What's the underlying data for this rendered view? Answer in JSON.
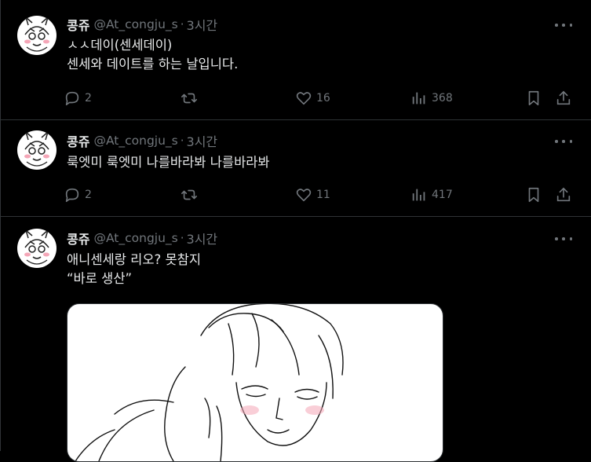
{
  "tweets": [
    {
      "name": "콩쥬",
      "handle": "@At_congju_s",
      "dot": "·",
      "time": "3시간",
      "lines": [
        "ㅅㅅ데이(센세데이)",
        "센세와 데이트를 하는 날입니다."
      ],
      "replies": "2",
      "likes": "16",
      "views": "368"
    },
    {
      "name": "콩쥬",
      "handle": "@At_congju_s",
      "dot": "·",
      "time": "3시간",
      "lines": [
        "룩엣미 룩엣미 나를바라봐 나를바라봐"
      ],
      "replies": "2",
      "likes": "11",
      "views": "417"
    },
    {
      "name": "콩쥬",
      "handle": "@At_congju_s",
      "dot": "·",
      "time": "3시간",
      "lines": [
        "애니센세랑 리오? 못참지",
        "“바로 생산”"
      ]
    }
  ],
  "colors": {
    "background": "#000000",
    "text": "#e7e9ea",
    "muted": "#71767b",
    "border": "#2f3336"
  },
  "icons": [
    "reply-icon",
    "retweet-icon",
    "like-icon",
    "views-icon",
    "bookmark-icon",
    "share-icon",
    "more-icon"
  ]
}
